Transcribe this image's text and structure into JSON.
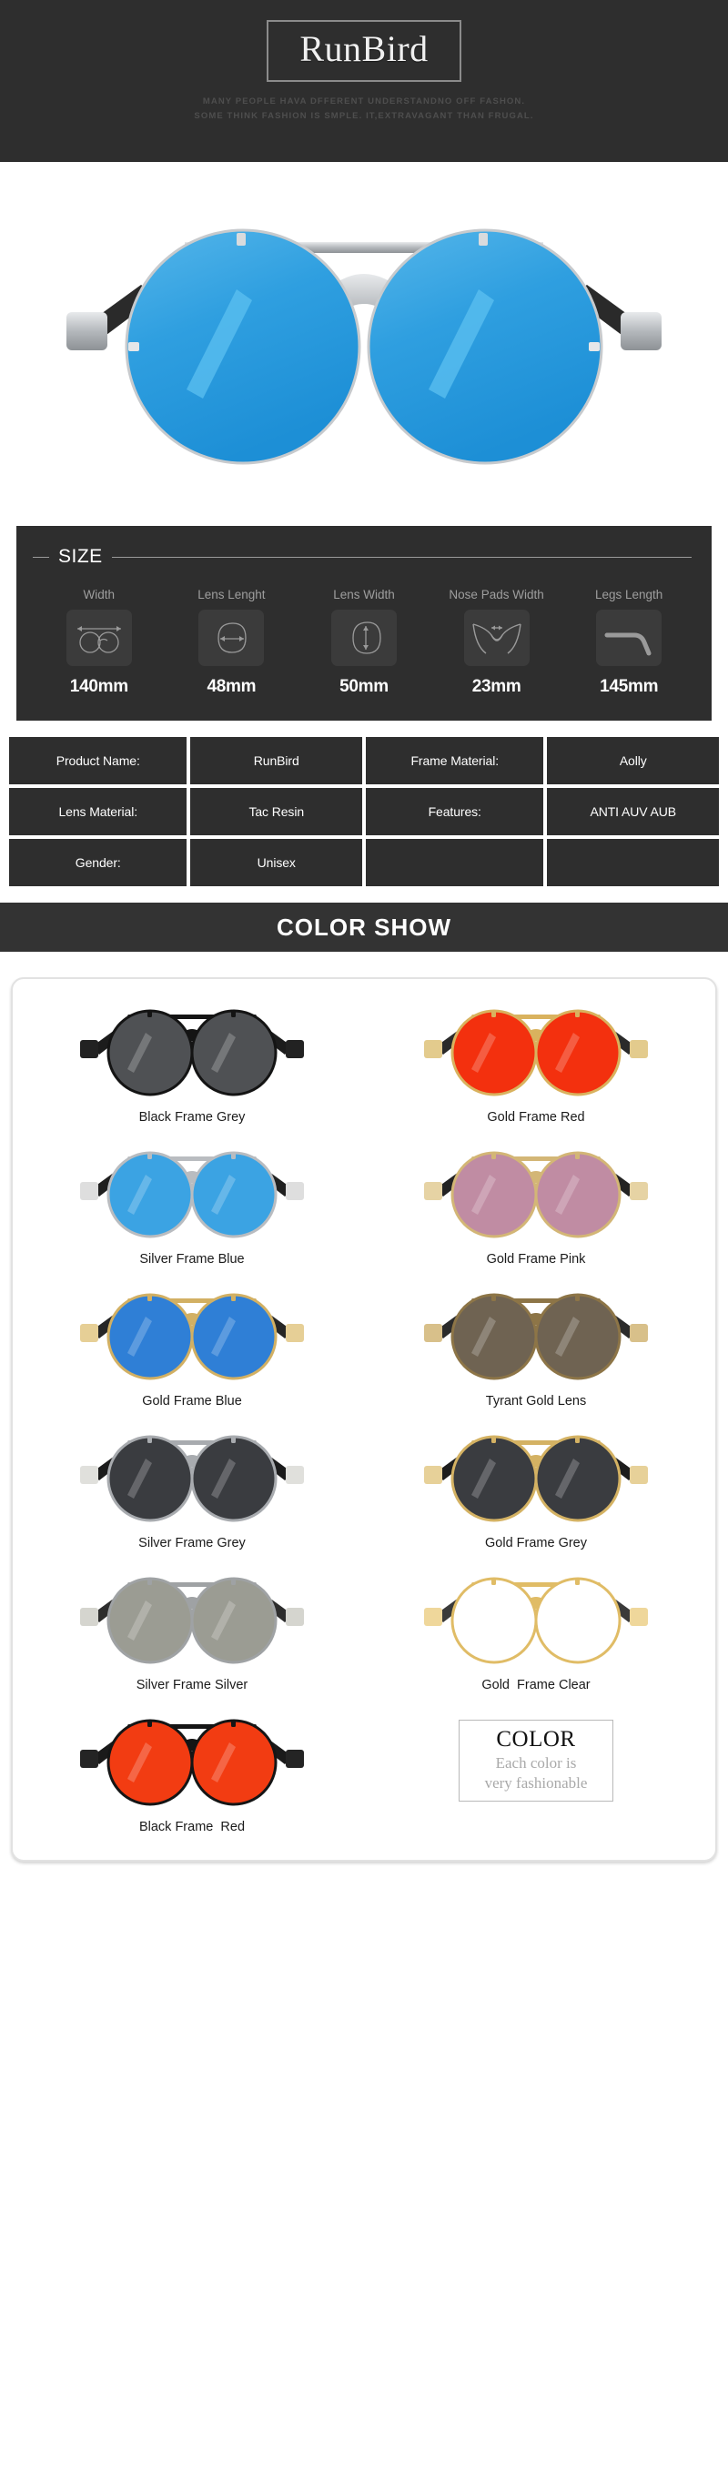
{
  "header": {
    "brand": "RunBird",
    "tagline_line1": "MANY PEOPLE HAVA DFFERENT UNDERSTANDNO OFF FASHON.",
    "tagline_line2": "SOME THINK FASHION IS SMPLE. IT,EXTRAVAGANT THAN FRUGAL.",
    "bg_color": "#2e2e2e"
  },
  "hero": {
    "alt": "silver-frame-blue-lens-round-sunglasses",
    "frame_color": "#b9bcc0",
    "lens_color": "#2f9fe0"
  },
  "size": {
    "title": "SIZE",
    "items": [
      {
        "label": "Width",
        "value": "140mm",
        "icon": "frame-width-icon"
      },
      {
        "label": "Lens Lenght",
        "value": "48mm",
        "icon": "lens-length-icon"
      },
      {
        "label": "Lens Width",
        "value": "50mm",
        "icon": "lens-width-icon"
      },
      {
        "label": "Nose Pads Width",
        "value": "23mm",
        "icon": "nose-pads-width-icon"
      },
      {
        "label": "Legs Length",
        "value": "145mm",
        "icon": "legs-length-icon"
      }
    ]
  },
  "specs": {
    "rows": [
      [
        {
          "key": "Product Name:",
          "value": "RunBird"
        },
        {
          "key": "Frame Material:",
          "value": "Aolly"
        }
      ],
      [
        {
          "key": "Lens Material:",
          "value": "Tac Resin"
        },
        {
          "key": "Features:",
          "value": "ANTI AUV AUB"
        }
      ],
      [
        {
          "key": "Gender:",
          "value": "Unisex"
        },
        {
          "key": "",
          "value": ""
        }
      ]
    ]
  },
  "color_show": {
    "banner_title": "COLOR  SHOW",
    "items": [
      {
        "name": "Black Frame Grey",
        "frame": "#141414",
        "lens": "#4f5154",
        "temple": "#1c1c1c",
        "tip": "#222222"
      },
      {
        "name": "Gold Frame Red",
        "frame": "#d9b25e",
        "lens": "#f3300e",
        "temple": "#2a2a2a",
        "tip": "#e3cb8d"
      },
      {
        "name": "Silver Frame Blue",
        "frame": "#b9bcc0",
        "lens": "#3ba3e3",
        "temple": "#1f1f1f",
        "tip": "#dedede"
      },
      {
        "name": "Gold Frame Pink",
        "frame": "#d3b676",
        "lens": "#c08ca3",
        "temple": "#232323",
        "tip": "#e6d3a4"
      },
      {
        "name": "Gold Frame Blue",
        "frame": "#d2b063",
        "lens": "#2f7fd6",
        "temple": "#262626",
        "tip": "#e6cf96"
      },
      {
        "name": "Tyrant Gold Lens",
        "frame": "#8d7547",
        "lens": "#6f6352",
        "temple": "#2b2b2b",
        "tip": "#d8c08a"
      },
      {
        "name": "Silver Frame Grey",
        "frame": "#a8abaf",
        "lens": "#3a3c40",
        "temple": "#1b1b1b",
        "tip": "#e0e0dc"
      },
      {
        "name": "Gold Frame Grey",
        "frame": "#d4b263",
        "lens": "#3a3c40",
        "temple": "#1d1d1d",
        "tip": "#e7d199"
      },
      {
        "name": "Silver Frame Silver",
        "frame": "#9fa2a4",
        "lens": "#9b9c93",
        "temple": "#2d2d2d",
        "tip": "#d5d5cf"
      },
      {
        "name": "Gold  Frame Clear",
        "frame": "#e0bc66",
        "lens": "#ffffff",
        "temple": "#3a3a3a",
        "tip": "#efd79b"
      },
      {
        "name": "Black Frame  Red",
        "frame": "#151515",
        "lens": "#f23c12",
        "temple": "#1a1a1a",
        "tip": "#242424"
      }
    ],
    "note": {
      "title": "COLOR",
      "line1": "Each color is",
      "line2": "very fashionable"
    }
  }
}
